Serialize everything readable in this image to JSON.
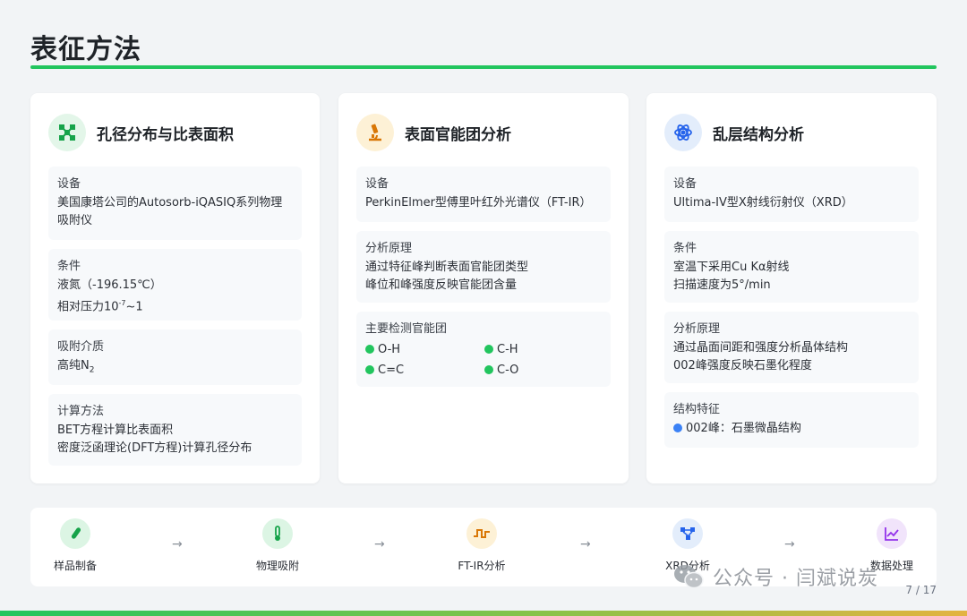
{
  "page": {
    "title": "表征方法"
  },
  "cards": [
    {
      "title": "孔径分布与比表面积",
      "icon": "network-icon",
      "blocks": [
        {
          "label": "设备",
          "lines": [
            "美国康塔公司的Autosorb-iQASIQ系列物理",
            "吸附仪"
          ]
        },
        {
          "label": "条件",
          "lines": [
            "液氮（-196.15℃）"
          ],
          "pressure_prefix": "相对压力10",
          "pressure_exp": "-7",
          "pressure_suffix": "~1"
        },
        {
          "label": "吸附介质",
          "gas_prefix": "高纯N",
          "gas_sub": "2"
        },
        {
          "label": "计算方法",
          "lines": [
            "BET方程计算比表面积",
            "密度泛函理论(DFT方程)计算孔径分布"
          ]
        }
      ]
    },
    {
      "title": "表面官能团分析",
      "icon": "microscope-icon",
      "blocks": [
        {
          "label": "设备",
          "lines": [
            "PerkinElmer型傅里叶红外光谱仪（FT-IR）"
          ]
        },
        {
          "label": "分析原理",
          "lines": [
            "通过特征峰判断表面官能团类型",
            "峰位和峰强度反映官能团含量"
          ]
        },
        {
          "label": "主要检测官能团",
          "groups": [
            "O-H",
            "C-H",
            "C=C",
            "C-O"
          ]
        }
      ]
    },
    {
      "title": "乱层结构分析",
      "icon": "atom-icon",
      "blocks": [
        {
          "label": "设备",
          "lines": [
            "Ultima-IV型X射线衍射仪（XRD）"
          ]
        },
        {
          "label": "条件",
          "lines": [
            "室温下采用Cu Kα射线",
            "扫描速度为5°/min"
          ]
        },
        {
          "label": "分析原理",
          "lines": [
            "通过晶面间距和强度分析晶体结构",
            "002峰强度反映石墨化程度"
          ]
        },
        {
          "label": "结构特征",
          "feature": "002峰：石墨微晶结构"
        }
      ]
    }
  ],
  "flow": {
    "steps": [
      {
        "label": "样品制备",
        "icon": "vial-icon"
      },
      {
        "label": "物理吸附",
        "icon": "thermometer-icon"
      },
      {
        "label": "FT-IR分析",
        "icon": "wave-icon"
      },
      {
        "label": "XRD分析",
        "icon": "diagram-icon"
      },
      {
        "label": "数据处理",
        "icon": "line-chart-icon"
      }
    ],
    "arrow": "→"
  },
  "footer": {
    "page_number": "7 / 17",
    "watermark": "公众号 · 闫斌说炭"
  },
  "colors": {
    "accent_green": "#22c55e",
    "accent_blue": "#3b82f6",
    "card_bg": "#ffffff",
    "block_bg": "#f7f9fb"
  }
}
